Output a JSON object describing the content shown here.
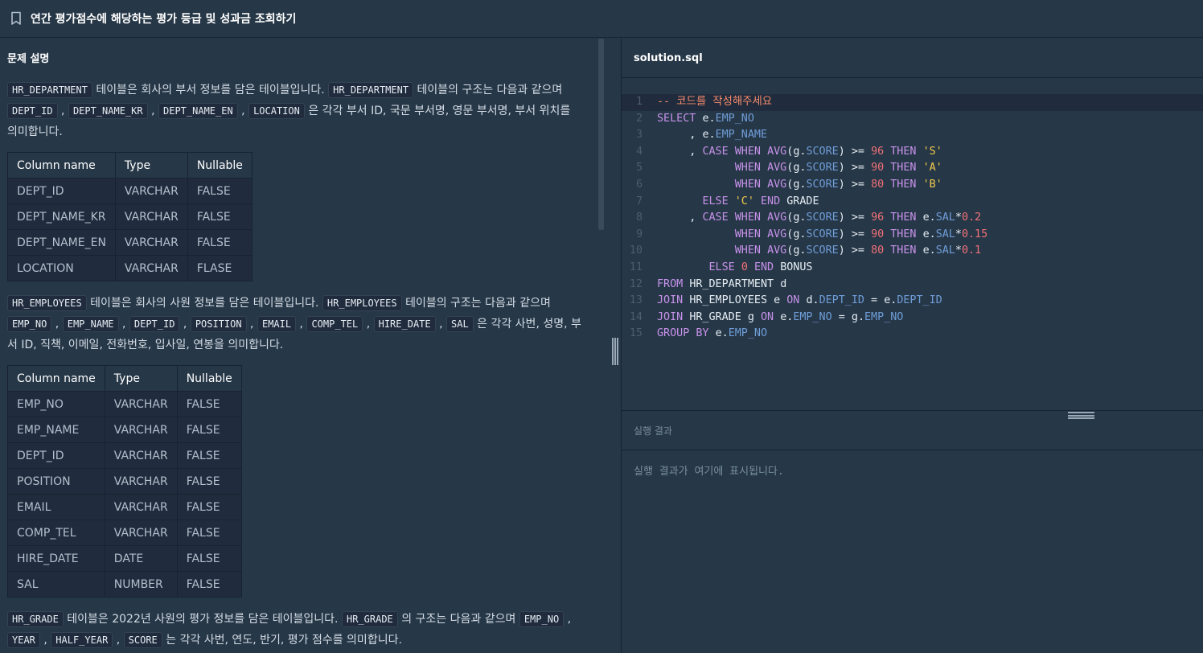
{
  "header": {
    "title": "연간 평가점수에 해당하는 평가 등급 및 성과금 조회하기",
    "bookmark_icon": "bookmark-icon"
  },
  "problem": {
    "section_title": "문제 설명",
    "dept": {
      "table_name": "HR_DEPARTMENT",
      "desc1": "테이블은 회사의 부서 정보를 담은 테이블입니다.",
      "desc2": "테이블의 구조는 다음과 같으며",
      "cols": [
        "DEPT_ID",
        "DEPT_NAME_KR",
        "DEPT_NAME_EN",
        "LOCATION"
      ],
      "desc3": "은 각각 부서 ID, 국문 부서명, 영문 부서명, 부서 위치를",
      "desc4": "의미합니다.",
      "headers": [
        "Column name",
        "Type",
        "Nullable"
      ],
      "rows": [
        [
          "DEPT_ID",
          "VARCHAR",
          "FALSE"
        ],
        [
          "DEPT_NAME_KR",
          "VARCHAR",
          "FALSE"
        ],
        [
          "DEPT_NAME_EN",
          "VARCHAR",
          "FALSE"
        ],
        [
          "LOCATION",
          "VARCHAR",
          "FLASE"
        ]
      ]
    },
    "emp": {
      "table_name": "HR_EMPLOYEES",
      "desc1": "테이블은 회사의 사원 정보를 담은 테이블입니다.",
      "desc2": "테이블의 구조는 다음과 같으며",
      "cols": [
        "EMP_NO",
        "EMP_NAME",
        "DEPT_ID",
        "POSITION",
        "EMAIL",
        "COMP_TEL",
        "HIRE_DATE",
        "SAL"
      ],
      "desc3": "은 각각 사번, 성명, 부",
      "desc4": "서 ID, 직책, 이메일, 전화번호, 입사일, 연봉을 의미합니다.",
      "headers": [
        "Column name",
        "Type",
        "Nullable"
      ],
      "rows": [
        [
          "EMP_NO",
          "VARCHAR",
          "FALSE"
        ],
        [
          "EMP_NAME",
          "VARCHAR",
          "FALSE"
        ],
        [
          "DEPT_ID",
          "VARCHAR",
          "FALSE"
        ],
        [
          "POSITION",
          "VARCHAR",
          "FALSE"
        ],
        [
          "EMAIL",
          "VARCHAR",
          "FALSE"
        ],
        [
          "COMP_TEL",
          "VARCHAR",
          "FALSE"
        ],
        [
          "HIRE_DATE",
          "DATE",
          "FALSE"
        ],
        [
          "SAL",
          "NUMBER",
          "FALSE"
        ]
      ]
    },
    "grade": {
      "table_name": "HR_GRADE",
      "desc1": "테이블은 2022년 사원의 평가 정보를 담은 테이블입니다.",
      "desc2": "의 구조는 다음과 같으며",
      "cols": [
        "EMP_NO",
        "YEAR",
        "HALF_YEAR",
        "SCORE"
      ],
      "desc3": "는 각각 사번, 연도, 반기, 평가 점수를 의미합니다."
    }
  },
  "editor": {
    "file_name": "solution.sql",
    "line_numbers": [
      "1",
      "2",
      "3",
      "4",
      "5",
      "6",
      "7",
      "8",
      "9",
      "10",
      "11",
      "12",
      "13",
      "14",
      "15"
    ],
    "code": {
      "l1": "-- 코드를 작성해주세요",
      "select": "SELECT",
      "e": "e",
      "d": "d",
      "g": "g",
      "emp_no": "EMP_NO",
      "emp_name": "EMP_NAME",
      "score": "SCORE",
      "sal": "SAL",
      "dept_id": "DEPT_ID",
      "case": "CASE",
      "when": "WHEN",
      "avg": "AVG",
      "then": "THEN",
      "else": "ELSE",
      "end": "END",
      "grade_alias": "GRADE",
      "bonus_alias": "BONUS",
      "n96": "96",
      "n90": "90",
      "n80": "80",
      "n0": "0",
      "sS": "'S'",
      "sA": "'A'",
      "sB": "'B'",
      "sC": "'C'",
      "r02": "0.2",
      "r015": "0.15",
      "r01": "0.1",
      "from": "FROM",
      "join": "JOIN",
      "on": "ON",
      "group_by": "GROUP BY",
      "t_dept": "HR_DEPARTMENT",
      "t_emp": "HR_EMPLOYEES",
      "t_grade": "HR_GRADE"
    }
  },
  "result": {
    "title": "실행 결과",
    "placeholder": "실행 결과가 여기에 표시됩니다."
  }
}
